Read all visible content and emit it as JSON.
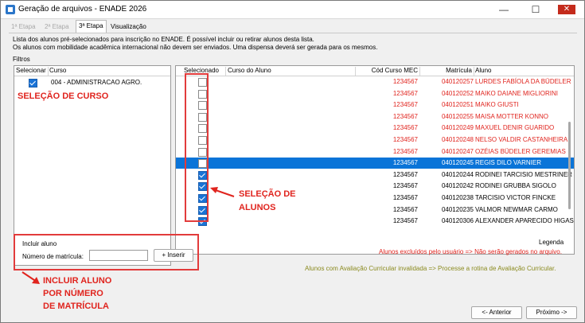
{
  "window": {
    "title": "Geração de arquivos - ENADE 2026",
    "close_glyph": "✕",
    "min_glyph": "—",
    "max_glyph": "☐"
  },
  "tabs": [
    {
      "label": "1ª Etapa",
      "state": "disabled"
    },
    {
      "label": "2ª Etapa",
      "state": "disabled"
    },
    {
      "label": "3ª Etapa",
      "state": "active"
    },
    {
      "label": "Visualização",
      "state": "normal"
    }
  ],
  "description": {
    "line1": "Lista dos alunos pré-selecionados para inscrição no ENADE. É possível incluir ou retirar alunos desta lista.",
    "line2": "Os alunos com mobilidade acadêmica internacional não devem ser enviados. Uma dispensa deverá ser gerada para os mesmos."
  },
  "filtros_label": "Filtros",
  "course_grid": {
    "headers": [
      "Selecionar",
      "Curso"
    ],
    "rows": [
      {
        "checked": true,
        "curso": "004 - ADMINISTRACAO AGRO."
      }
    ]
  },
  "student_grid": {
    "headers": [
      "Selecionado",
      "Curso do Aluno",
      "Cód Curso MEC",
      "Matrícula",
      "Aluno"
    ],
    "rows": [
      {
        "checked": false,
        "mec": "1234567",
        "matricula": "040120257",
        "aluno": "LURDES FABÍOLA DA BÜDELER",
        "excluded": true,
        "selected": false
      },
      {
        "checked": false,
        "mec": "1234567",
        "matricula": "040120252",
        "aluno": "MAIKO DAIANE MIGLIORINI",
        "excluded": true,
        "selected": false
      },
      {
        "checked": false,
        "mec": "1234567",
        "matricula": "040120251",
        "aluno": "MAIKO GIUSTI",
        "excluded": true,
        "selected": false
      },
      {
        "checked": false,
        "mec": "1234567",
        "matricula": "040120255",
        "aluno": "MAISA MOTTER KONNO",
        "excluded": true,
        "selected": false
      },
      {
        "checked": false,
        "mec": "1234567",
        "matricula": "040120249",
        "aluno": "MAXUEL DENIR GUARIDO",
        "excluded": true,
        "selected": false
      },
      {
        "checked": false,
        "mec": "1234567",
        "matricula": "040120248",
        "aluno": "NELSO VALDIR CASTANHEIRA",
        "excluded": true,
        "selected": false
      },
      {
        "checked": false,
        "mec": "1234567",
        "matricula": "040120247",
        "aluno": "OZÉIAS BÜDELER GEREMIAS",
        "excluded": true,
        "selected": false
      },
      {
        "checked": false,
        "mec": "1234567",
        "matricula": "040120245",
        "aluno": "REGIS DILO VARNIER",
        "excluded": false,
        "selected": true
      },
      {
        "checked": true,
        "mec": "1234567",
        "matricula": "040120244",
        "aluno": "RODINEI TARCISIO MESTRINER",
        "excluded": false,
        "selected": false
      },
      {
        "checked": true,
        "mec": "1234567",
        "matricula": "040120242",
        "aluno": "RODINEI GRUBBA SIGOLO",
        "excluded": false,
        "selected": false
      },
      {
        "checked": true,
        "mec": "1234567",
        "matricula": "040120238",
        "aluno": "TARCISIO VICTOR FINCKE",
        "excluded": false,
        "selected": false
      },
      {
        "checked": true,
        "mec": "1234567",
        "matricula": "040120235",
        "aluno": "VALMOR NEWMAR CARMO",
        "excluded": false,
        "selected": false
      },
      {
        "checked": true,
        "mec": "1234567",
        "matricula": "040120306",
        "aluno": "ALEXANDER APARECIDO HIGAS",
        "excluded": false,
        "selected": false
      }
    ]
  },
  "incluir": {
    "title": "Incluir aluno",
    "label": "Número de matrícula:",
    "value": "",
    "button": "+ Inserir"
  },
  "legenda": {
    "title": "Legenda",
    "excluded": "Alunos excluídos pelo usuário => Não serão gerados no arquivo.",
    "invalid": "Alunos com Avaliação Curricular invalidada => Processe a rotina de Avaliação Curricular."
  },
  "buttons": {
    "anterior": "<- Anterior",
    "proximo": "Próximo ->"
  },
  "annotations": {
    "curso": "SELEÇÃO DE CURSO",
    "alunos_1": "SELEÇÃO DE",
    "alunos_2": "ALUNOS",
    "incluir_1": "INCLUIR ALUNO",
    "incluir_2": "POR NÚMERO",
    "incluir_3": "DE MATRÍCULA"
  },
  "colors": {
    "selected_row": "#0a74d8",
    "excluded_text": "#e0241e",
    "annotation": "#e23b3b",
    "invalid_text": "#8a8a1e"
  }
}
